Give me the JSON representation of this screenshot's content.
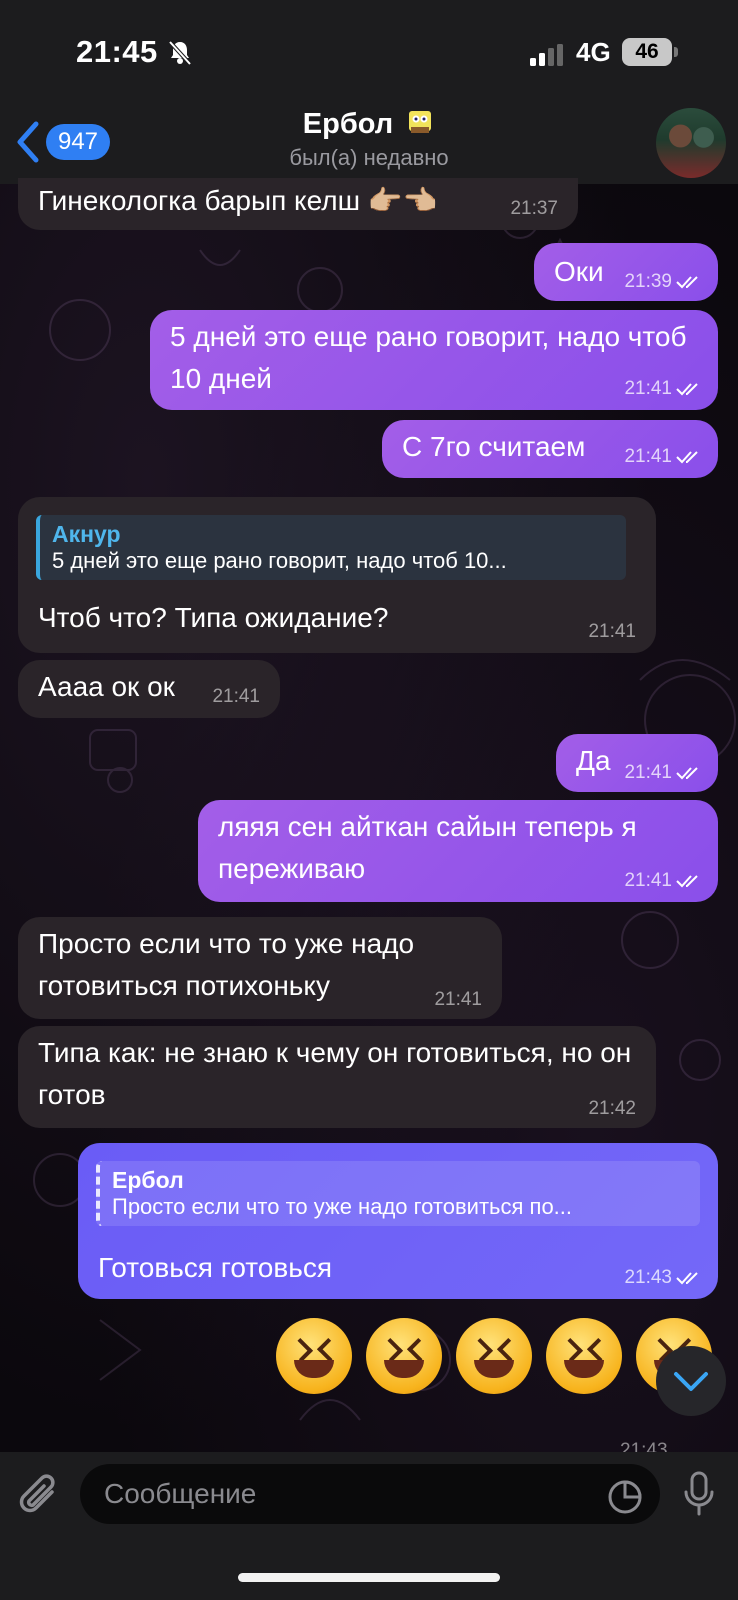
{
  "status_bar": {
    "time": "21:45",
    "network": "4G",
    "battery": "46"
  },
  "header": {
    "back_count": "947",
    "title": "Ербол",
    "subtitle": "был(а) недавно"
  },
  "messages": [
    {
      "dir": "in",
      "text": "Гинекологка барып келш 👉🏼👈🏼",
      "time": "21:37"
    },
    {
      "dir": "out",
      "text": "Оки",
      "time": "21:39"
    },
    {
      "dir": "out",
      "text": "5 дней это еще рано говорит, надо чтоб 10 дней",
      "time": "21:41"
    },
    {
      "dir": "out",
      "text": "С 7го считаем",
      "time": "21:41"
    },
    {
      "dir": "in",
      "reply_name": "Акнур",
      "reply_text": "5 дней это еще рано говорит, надо чтоб 10...",
      "text": "Чтоб что? Типа ожидание?",
      "time": "21:41"
    },
    {
      "dir": "in",
      "text": "Аааа ок ок",
      "time": "21:41"
    },
    {
      "dir": "out",
      "text": "Да",
      "time": "21:41"
    },
    {
      "dir": "out",
      "text": "ляяя сен айткан сайын теперь я переживаю",
      "time": "21:41"
    },
    {
      "dir": "in",
      "text": "Просто если что то уже надо готовиться потихоньку",
      "time": "21:41"
    },
    {
      "dir": "in",
      "text": "Типа как: не знаю к чему он готовиться, но он готов",
      "time": "21:42"
    },
    {
      "dir": "out",
      "reply_name": "Ербол",
      "reply_text": "Просто если что то уже надо готовиться по...",
      "text": "Готовься готовься",
      "time": "21:43"
    },
    {
      "dir": "out",
      "text": "😆😆😆😆😆",
      "time": "21:43"
    }
  ],
  "input": {
    "placeholder": "Сообщение"
  },
  "icons": [
    "bell-slash-icon",
    "signal-icon",
    "back-chevron-icon",
    "avatar",
    "double-check-icon",
    "attach-icon",
    "sticker-icon",
    "mic-icon",
    "chevron-down-icon"
  ],
  "colors": {
    "accent": "#2f7ff3",
    "out_bubble": "#9a5aea",
    "out_bubble_blue": "#6f62f7",
    "in_bubble": "#2a2429",
    "reply_accent": "#4fb6ec"
  }
}
